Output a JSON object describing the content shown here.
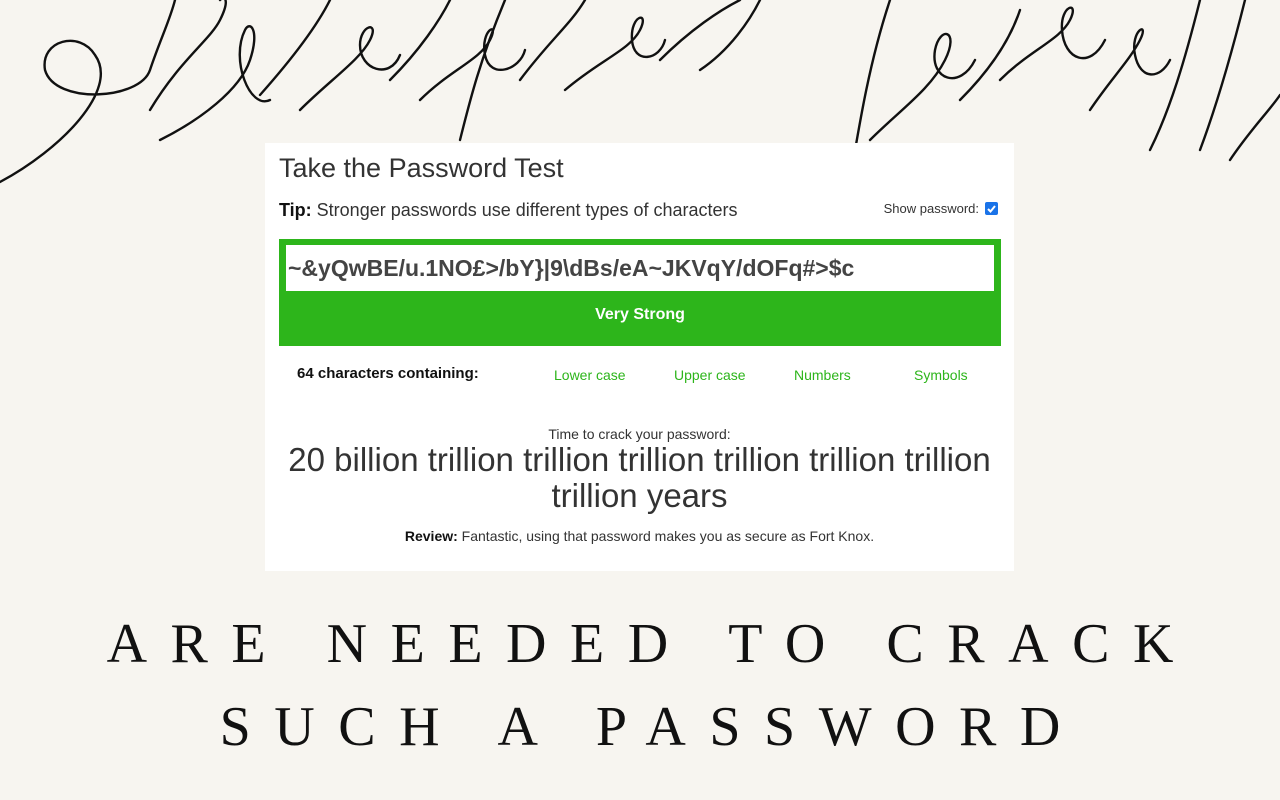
{
  "signature": {
    "text": "Sebastiano Beretta"
  },
  "panel": {
    "title": "Take the Password Test",
    "tip_label": "Tip:",
    "tip_text": " Stronger passwords use different types of characters",
    "show_password_label": "Show password:",
    "show_password_checked": true,
    "password_value": "~&yQwBE/u.1NO£>/bY}|9\\dBs/eA~JKVqY/dOFq#>$c",
    "strength": "Very Strong",
    "strength_color": "#2db51b",
    "contains_label": "64 characters containing:",
    "char_types": [
      "Lower case",
      "Upper case",
      "Numbers",
      "Symbols"
    ],
    "crack_label": "Time to crack your password:",
    "crack_time": "20 billion trillion trillion trillion trillion trillion trillion trillion years",
    "review_label": "Review:",
    "review_text": " Fantastic, using that password makes you as secure as Fort Knox."
  },
  "caption": {
    "line1": "ARE NEEDED TO CRACK",
    "line2": "SUCH A PASSWORD"
  },
  "colors": {
    "background": "#f7f5f0",
    "accent_green": "#2db51b",
    "checkbox_blue": "#1a73e8",
    "caption_text": "#111111"
  },
  "icons": {
    "checkbox": "checkmark-icon"
  }
}
